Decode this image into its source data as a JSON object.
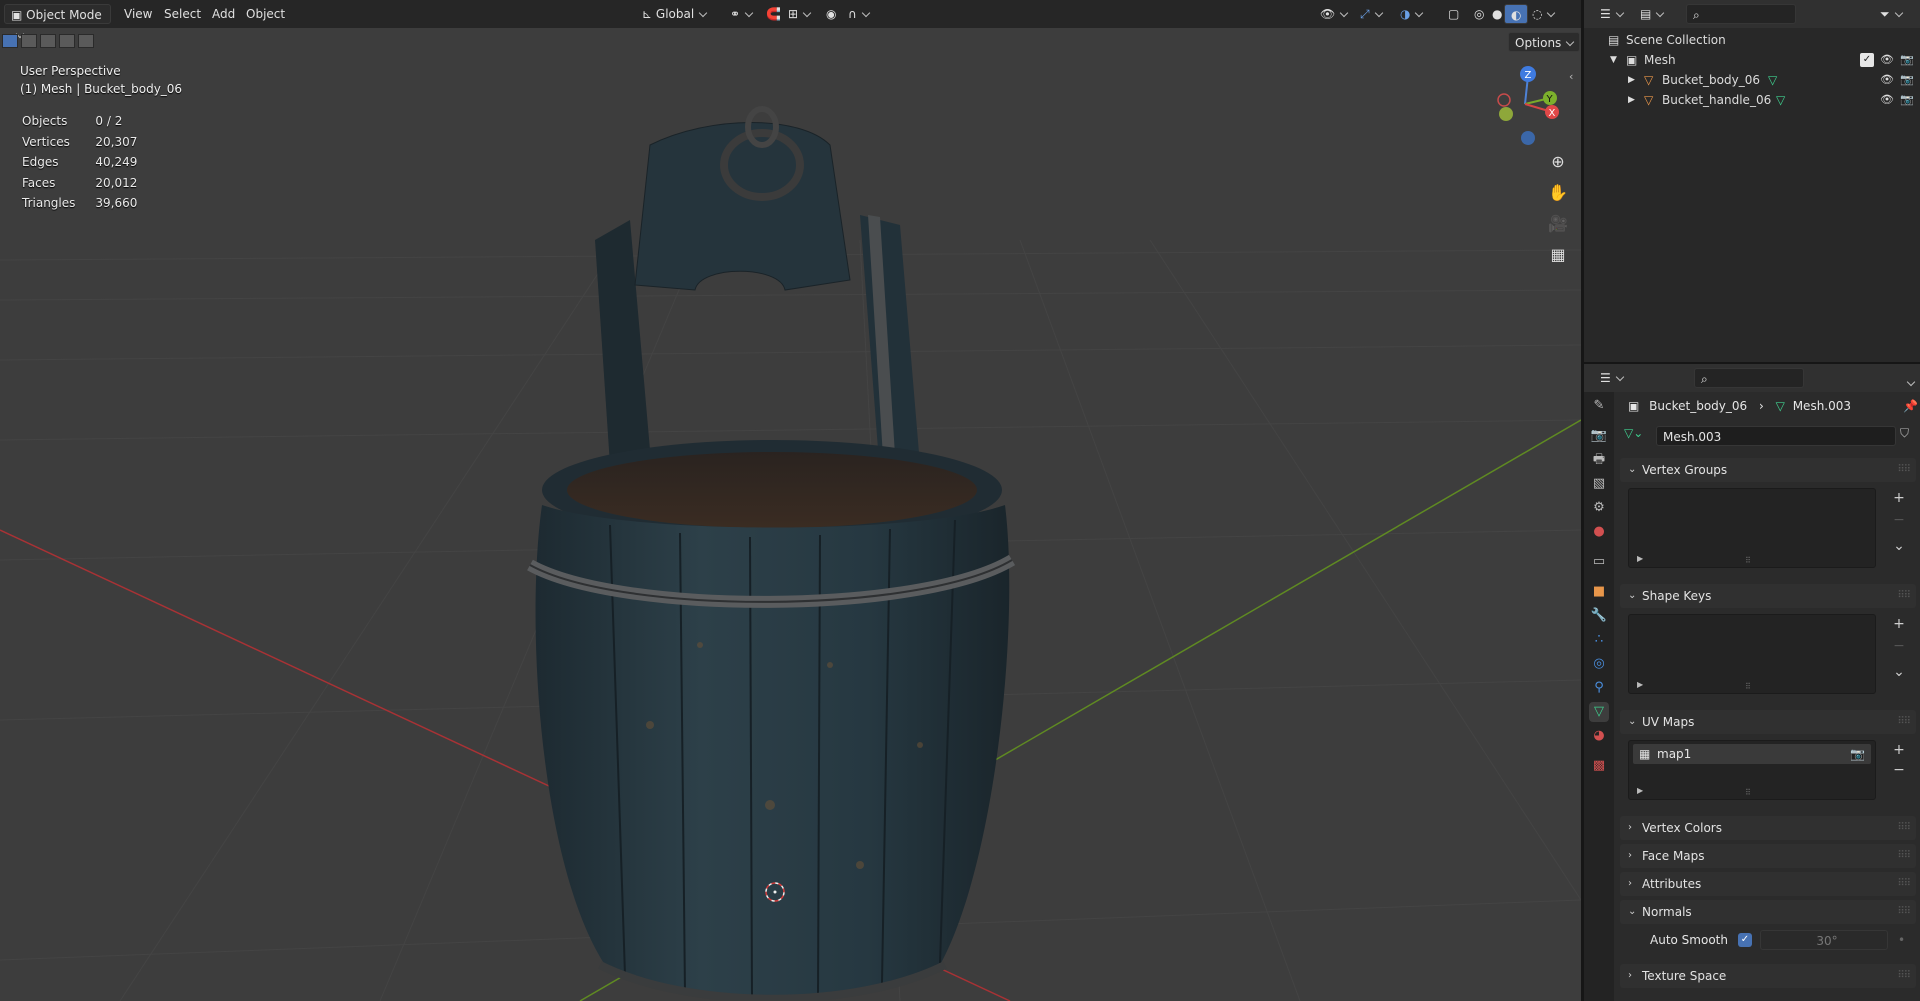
{
  "header": {
    "mode": "Object Mode",
    "menus": [
      "View",
      "Select",
      "Add",
      "Object"
    ],
    "transform_orientation": "Global",
    "options_label": "Options"
  },
  "viewport": {
    "view_name": "User Perspective",
    "object_info": "(1) Mesh | Bucket_body_06",
    "stats": [
      {
        "label": "Objects",
        "value": "0 / 2"
      },
      {
        "label": "Vertices",
        "value": "20,307"
      },
      {
        "label": "Edges",
        "value": "40,249"
      },
      {
        "label": "Faces",
        "value": "20,012"
      },
      {
        "label": "Triangles",
        "value": "39,660"
      }
    ],
    "gizmo": {
      "z": "Z",
      "y": "Y",
      "x": "X"
    }
  },
  "outliner": {
    "root": "Scene Collection",
    "collection": "Mesh",
    "objects": [
      "Bucket_body_06",
      "Bucket_handle_06"
    ]
  },
  "properties": {
    "breadcrumb_object": "Bucket_body_06",
    "breadcrumb_data": "Mesh.003",
    "datablock_name": "Mesh.003",
    "panels": {
      "vertex_groups": "Vertex Groups",
      "shape_keys": "Shape Keys",
      "uv_maps": "UV Maps",
      "vertex_colors": "Vertex Colors",
      "face_maps": "Face Maps",
      "attributes": "Attributes",
      "normals": "Normals",
      "texture_space": "Texture Space"
    },
    "uv_map_item": "map1",
    "auto_smooth_label": "Auto Smooth",
    "auto_smooth_checked": true,
    "auto_smooth_angle": "30°"
  },
  "colors": {
    "accent": "#4772b3",
    "viewport_bg": "#3d3d3d",
    "axis_x": "#c0393b",
    "axis_y": "#6b9a23",
    "bucket_wood": "#2a3942"
  }
}
